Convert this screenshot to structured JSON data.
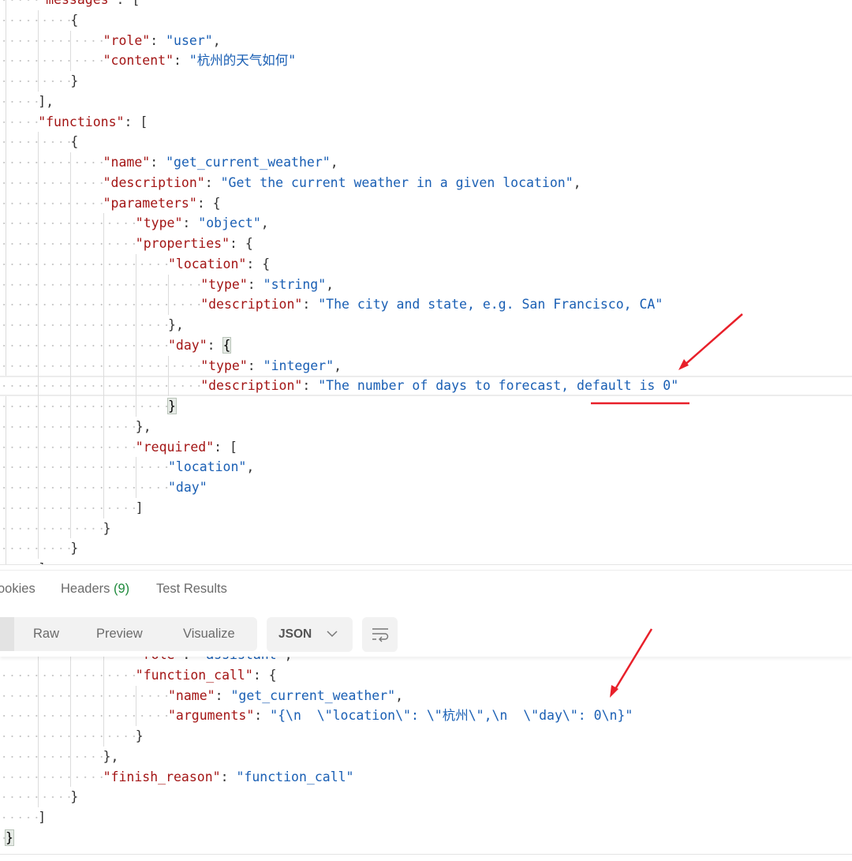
{
  "request_body": {
    "lines": [
      {
        "indent": 1,
        "parts": [
          [
            "k",
            "\"messages\""
          ],
          [
            "p",
            ": ["
          ]
        ]
      },
      {
        "indent": 2,
        "parts": [
          [
            "p",
            "{"
          ]
        ]
      },
      {
        "indent": 3,
        "parts": [
          [
            "k",
            "\"role\""
          ],
          [
            "p",
            ": "
          ],
          [
            "s",
            "\"user\""
          ],
          [
            "p",
            ","
          ]
        ]
      },
      {
        "indent": 3,
        "parts": [
          [
            "k",
            "\"content\""
          ],
          [
            "p",
            ": "
          ],
          [
            "s",
            "\"杭州的天气如何\""
          ]
        ]
      },
      {
        "indent": 2,
        "parts": [
          [
            "p",
            "}"
          ]
        ]
      },
      {
        "indent": 1,
        "parts": [
          [
            "p",
            "],"
          ]
        ]
      },
      {
        "indent": 1,
        "parts": [
          [
            "k",
            "\"functions\""
          ],
          [
            "p",
            ": ["
          ]
        ]
      },
      {
        "indent": 2,
        "parts": [
          [
            "p",
            "{"
          ]
        ]
      },
      {
        "indent": 3,
        "parts": [
          [
            "k",
            "\"name\""
          ],
          [
            "p",
            ": "
          ],
          [
            "s",
            "\"get_current_weather\""
          ],
          [
            "p",
            ","
          ]
        ]
      },
      {
        "indent": 3,
        "parts": [
          [
            "k",
            "\"description\""
          ],
          [
            "p",
            ": "
          ],
          [
            "s",
            "\"Get the current weather in a given location\""
          ],
          [
            "p",
            ","
          ]
        ]
      },
      {
        "indent": 3,
        "parts": [
          [
            "k",
            "\"parameters\""
          ],
          [
            "p",
            ": {"
          ]
        ]
      },
      {
        "indent": 4,
        "parts": [
          [
            "k",
            "\"type\""
          ],
          [
            "p",
            ": "
          ],
          [
            "s",
            "\"object\""
          ],
          [
            "p",
            ","
          ]
        ]
      },
      {
        "indent": 4,
        "parts": [
          [
            "k",
            "\"properties\""
          ],
          [
            "p",
            ": {"
          ]
        ]
      },
      {
        "indent": 5,
        "parts": [
          [
            "k",
            "\"location\""
          ],
          [
            "p",
            ": {"
          ]
        ]
      },
      {
        "indent": 6,
        "parts": [
          [
            "k",
            "\"type\""
          ],
          [
            "p",
            ": "
          ],
          [
            "s",
            "\"string\""
          ],
          [
            "p",
            ","
          ]
        ]
      },
      {
        "indent": 6,
        "parts": [
          [
            "k",
            "\"description\""
          ],
          [
            "p",
            ": "
          ],
          [
            "s",
            "\"The city and state, e.g. San Francisco, CA\""
          ]
        ]
      },
      {
        "indent": 5,
        "parts": [
          [
            "p",
            "},"
          ]
        ]
      },
      {
        "indent": 5,
        "parts": [
          [
            "k",
            "\"day\""
          ],
          [
            "p",
            ": "
          ],
          [
            "box",
            "{"
          ]
        ]
      },
      {
        "indent": 6,
        "parts": [
          [
            "k",
            "\"type\""
          ],
          [
            "p",
            ": "
          ],
          [
            "s",
            "\"integer\""
          ],
          [
            "p",
            ","
          ]
        ]
      },
      {
        "indent": 6,
        "highlight": true,
        "parts": [
          [
            "k",
            "\"description\""
          ],
          [
            "p",
            ": "
          ],
          [
            "s",
            "\"The number of days to forecast, default is 0\""
          ]
        ]
      },
      {
        "indent": 5,
        "parts": [
          [
            "box",
            "}"
          ]
        ]
      },
      {
        "indent": 4,
        "parts": [
          [
            "p",
            "},"
          ]
        ]
      },
      {
        "indent": 4,
        "parts": [
          [
            "k",
            "\"required\""
          ],
          [
            "p",
            ": ["
          ]
        ]
      },
      {
        "indent": 5,
        "parts": [
          [
            "s",
            "\"location\""
          ],
          [
            "p",
            ","
          ]
        ]
      },
      {
        "indent": 5,
        "parts": [
          [
            "s",
            "\"day\""
          ]
        ]
      },
      {
        "indent": 4,
        "parts": [
          [
            "p",
            "]"
          ]
        ]
      },
      {
        "indent": 3,
        "parts": [
          [
            "p",
            "}"
          ]
        ]
      },
      {
        "indent": 2,
        "parts": [
          [
            "p",
            "}"
          ]
        ]
      },
      {
        "indent": 1,
        "parts": [
          [
            "p",
            "]"
          ]
        ]
      }
    ]
  },
  "response_tabs": {
    "cookies": "ookies",
    "headers": "Headers",
    "headers_count": "(9)",
    "test_results": "Test Results"
  },
  "toolbar": {
    "raw": "Raw",
    "preview": "Preview",
    "visualize": "Visualize",
    "format": "JSON",
    "format_icon": "chevron-down-icon",
    "wrap_icon": "wrap-lines-icon"
  },
  "response_body": {
    "lines": [
      {
        "indent": 4,
        "parts": [
          [
            "k",
            "\"role\""
          ],
          [
            "p",
            ": "
          ],
          [
            "s",
            "\"assistant\""
          ],
          [
            "p",
            ","
          ]
        ]
      },
      {
        "indent": 4,
        "parts": [
          [
            "k",
            "\"function_call\""
          ],
          [
            "p",
            ": {"
          ]
        ]
      },
      {
        "indent": 5,
        "parts": [
          [
            "k",
            "\"name\""
          ],
          [
            "p",
            ": "
          ],
          [
            "s",
            "\"get_current_weather\""
          ],
          [
            "p",
            ","
          ]
        ]
      },
      {
        "indent": 5,
        "parts": [
          [
            "k",
            "\"arguments\""
          ],
          [
            "p",
            ": "
          ],
          [
            "s",
            "\"{\\n  \\\"location\\\": \\\"杭州\\\",\\n  \\\"day\\\": 0\\n}\""
          ]
        ]
      },
      {
        "indent": 4,
        "parts": [
          [
            "p",
            "}"
          ]
        ]
      },
      {
        "indent": 3,
        "parts": [
          [
            "p",
            "},"
          ]
        ]
      },
      {
        "indent": 3,
        "parts": [
          [
            "k",
            "\"finish_reason\""
          ],
          [
            "p",
            ": "
          ],
          [
            "s",
            "\"function_call\""
          ]
        ]
      },
      {
        "indent": 2,
        "parts": [
          [
            "p",
            "}"
          ]
        ]
      },
      {
        "indent": 1,
        "parts": [
          [
            "p",
            "]"
          ]
        ]
      },
      {
        "indent": 0,
        "parts": [
          [
            "box",
            "}"
          ]
        ]
      }
    ]
  },
  "colors": {
    "key": "#a31515",
    "string": "#1a5fb4",
    "annotation": "#e8202a",
    "badge": "#1e8a3c"
  }
}
